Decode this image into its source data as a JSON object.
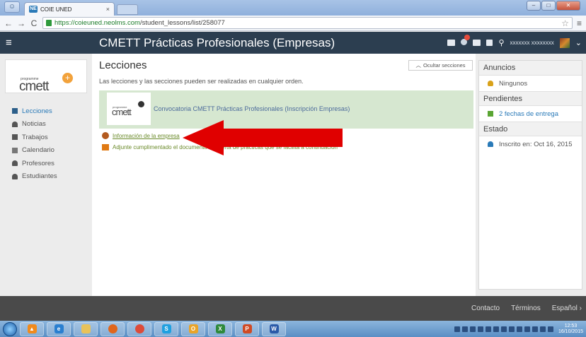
{
  "browser": {
    "tab_title": "COIE UNED",
    "favicon_text": "NE",
    "url_host": "https://coieuned.neolms.com",
    "url_path": "/student_lessons/list/258077"
  },
  "header": {
    "title": "CMETT Prácticas Profesionales (Empresas)",
    "username": "xxxxxxx xxxxxxxx"
  },
  "sidebar": {
    "logo_small": "programme",
    "logo_main": "cmett",
    "items": [
      {
        "label": "Lecciones",
        "icon": "lessons-icon"
      },
      {
        "label": "Noticias",
        "icon": "news-icon"
      },
      {
        "label": "Trabajos",
        "icon": "assignments-icon"
      },
      {
        "label": "Calendario",
        "icon": "calendar-icon"
      },
      {
        "label": "Profesores",
        "icon": "teacher-icon"
      },
      {
        "label": "Estudiantes",
        "icon": "students-icon"
      }
    ]
  },
  "main": {
    "title": "Lecciones",
    "hide_sections_label": "Ocultar secciones",
    "subtitle": "Las lecciones y las secciones pueden ser realizadas en cualquier orden.",
    "card": {
      "title": "Convocatoria CMETT Prácticas Profesionales (Inscripción Empresas)",
      "logo_small": "programme",
      "logo_main": "cmett"
    },
    "items": [
      {
        "label": "Información de la empresa"
      },
      {
        "label": "Adjunte cumplimentado el documento de oferta de prácticas que se facilita a continuación"
      }
    ]
  },
  "right_panel": {
    "announcements_title": "Anuncios",
    "announcements_value": "Ningunos",
    "pending_title": "Pendientes",
    "pending_value": "2 fechas de entrega",
    "status_title": "Estado",
    "status_value": "Inscrito en: Oct 16, 2015"
  },
  "footer": {
    "contact": "Contacto",
    "terms": "Términos",
    "language": "Español ›"
  },
  "taskbar": {
    "time": "12:53",
    "date": "16/10/2015"
  },
  "colors": {
    "header_bg": "#2c3e50",
    "card_bg": "#d6e7d0",
    "link_blue": "#2a7ab8",
    "item_green": "#6a8a2a",
    "arrow_red": "#e00000"
  }
}
